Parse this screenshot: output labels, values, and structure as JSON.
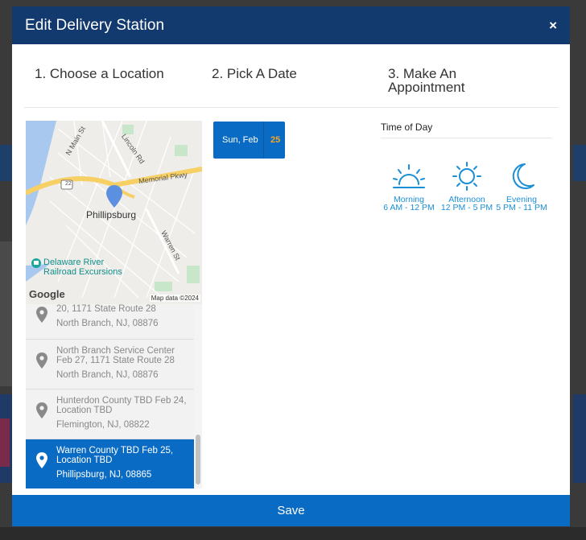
{
  "modal": {
    "title": "Edit Delivery Station",
    "close_label": "×",
    "save_label": "Save"
  },
  "steps": [
    {
      "label": "1. Choose a Location"
    },
    {
      "label": "2. Pick A Date"
    },
    {
      "label": "3. Make An Appointment"
    }
  ],
  "map": {
    "city_label": "Phillipsburg",
    "poi_label_line1": "Delaware River",
    "poi_label_line2": "Railroad Excursions",
    "road_memorial": "Memorial Pkwy",
    "road_lincoln": "Lincoln Rd",
    "road_main": "N Main St",
    "road_warren": "Warren St",
    "route_shield": "22",
    "google_logo": "Google",
    "attribution": "Map data ©2024"
  },
  "locations": [
    {
      "name": "20, 1171 State Route 28",
      "address": "North Branch, NJ, 08876",
      "selected": false
    },
    {
      "name": "North Branch Service Center Feb 27, 1171 State Route 28",
      "address": "North Branch, NJ, 08876",
      "selected": false
    },
    {
      "name": "Hunterdon County TBD Feb 24, Location TBD",
      "address": "Flemington, NJ, 08822",
      "selected": false
    },
    {
      "name": "Warren County TBD Feb 25, Location TBD",
      "address": "Phillipsburg, NJ, 08865",
      "selected": true
    }
  ],
  "date": {
    "label": "Sun, Feb",
    "day": "25"
  },
  "time_of_day": {
    "title": "Time of Day",
    "options": [
      {
        "name": "Morning",
        "range": "6 AM - 12 PM",
        "icon": "sunrise-icon"
      },
      {
        "name": "Afternoon",
        "range": "12 PM - 5 PM",
        "icon": "sun-icon"
      },
      {
        "name": "Evening",
        "range": "5 PM - 11 PM",
        "icon": "moon-icon"
      }
    ]
  },
  "colors": {
    "header": "#133a6e",
    "primary": "#0a6bc4",
    "accent": "#f5a623",
    "icon_blue": "#1a8fd6"
  }
}
